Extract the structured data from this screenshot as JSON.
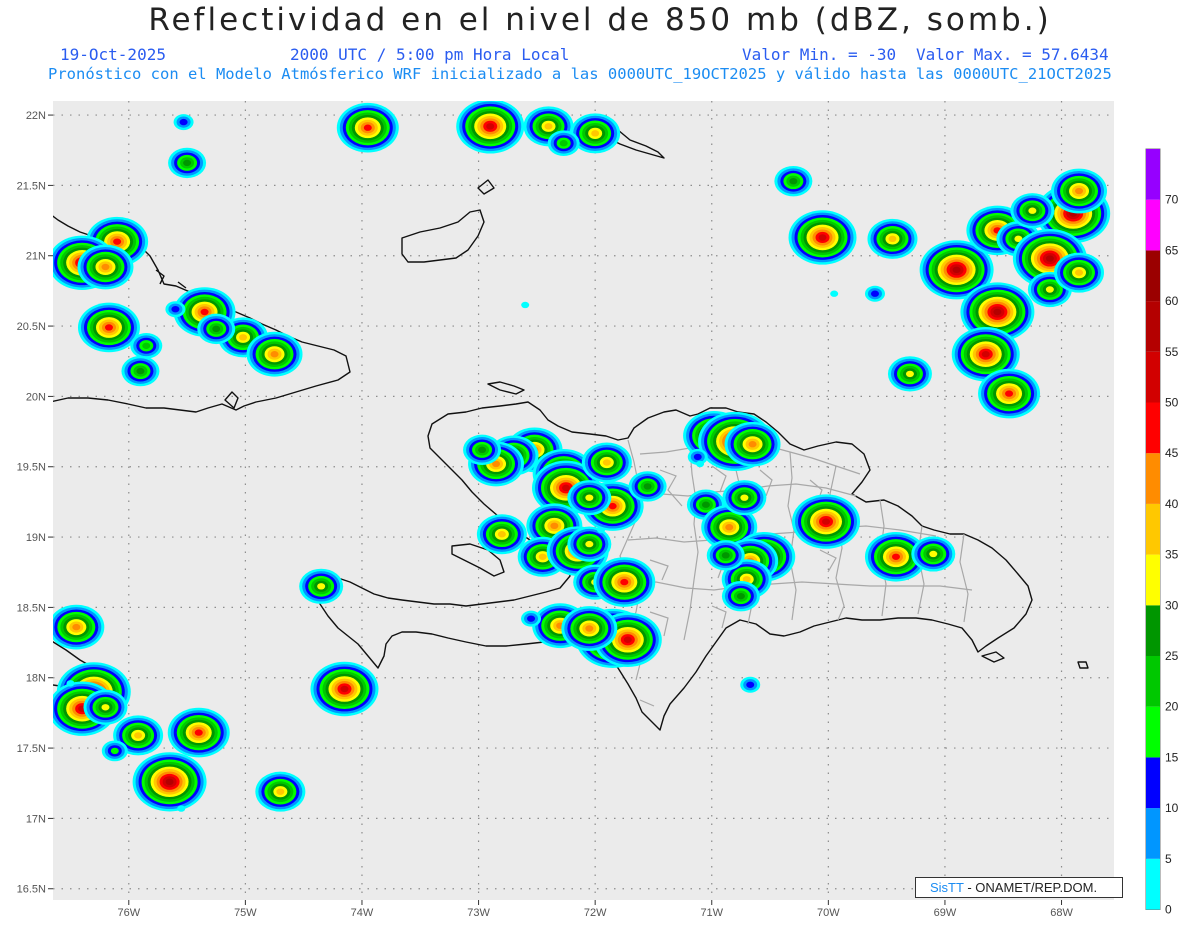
{
  "title": "Reflectividad en el nivel de 850 mb (dBZ, somb.)",
  "subtitle": {
    "date": "19-Oct-2025",
    "time": "2000 UTC / 5:00 pm Hora Local",
    "valor_min": "Valor Min. = -30",
    "valor_max": "Valor Max. = 57.6434"
  },
  "description": "Pronóstico con el Modelo Atmósferico WRF inicializado a las 0000UTC_19OCT2025 y válido hasta las  0000UTC_21OCT2025",
  "credit": {
    "sis": "SisTT",
    "org": " - ONAMET/REP.DOM."
  },
  "map": {
    "lon_range": [
      -76.65,
      -67.55
    ],
    "lat_range": [
      16.42,
      22.1
    ],
    "lat_labels": [
      "22N",
      "21.5N",
      "21N",
      "20.5N",
      "20N",
      "19.5N",
      "19N",
      "18.5N",
      "18N",
      "17.5N",
      "17N",
      "16.5N"
    ],
    "lat_values": [
      22,
      21.5,
      21,
      20.5,
      20,
      19.5,
      19,
      18.5,
      18,
      17.5,
      17,
      16.5
    ],
    "lon_labels": [
      "76W",
      "75W",
      "74W",
      "73W",
      "72W",
      "71W",
      "70W",
      "69W",
      "68W"
    ],
    "lon_values": [
      -76,
      -75,
      -74,
      -73,
      -72,
      -71,
      -70,
      -69,
      -68
    ],
    "background": "#ebebeb"
  },
  "colorbar": {
    "levels": [
      "0",
      "5",
      "10",
      "15",
      "20",
      "25",
      "30",
      "35",
      "40",
      "45",
      "50",
      "55",
      "60",
      "65",
      "70"
    ],
    "colors": [
      "#00ffff",
      "#0096ff",
      "#0000ff",
      "#00ff00",
      "#00c800",
      "#009600",
      "#ffff00",
      "#ffc800",
      "#ff8c00",
      "#ff0000",
      "#d20000",
      "#b40000",
      "#9b0000",
      "#ff00ff",
      "#9600ff"
    ]
  },
  "echoes": [
    {
      "lon": -75.53,
      "lat": 21.95,
      "dbz": 12
    },
    {
      "lon": -75.5,
      "lat": 21.66,
      "dbz": 28
    },
    {
      "lon": -73.95,
      "lat": 21.91,
      "dbz": 45
    },
    {
      "lon": -72.9,
      "lat": 21.92,
      "dbz": 50
    },
    {
      "lon": -72.4,
      "lat": 21.92,
      "dbz": 35
    },
    {
      "lon": -72.0,
      "lat": 21.87,
      "dbz": 35
    },
    {
      "lon": -72.27,
      "lat": 21.8,
      "dbz": 20
    },
    {
      "lon": -70.3,
      "lat": 21.53,
      "dbz": 28
    },
    {
      "lon": -76.1,
      "lat": 21.1,
      "dbz": 45
    },
    {
      "lon": -76.4,
      "lat": 20.95,
      "dbz": 50
    },
    {
      "lon": -76.2,
      "lat": 20.92,
      "dbz": 40
    },
    {
      "lon": -75.35,
      "lat": 20.6,
      "dbz": 45
    },
    {
      "lon": -75.02,
      "lat": 20.42,
      "dbz": 35
    },
    {
      "lon": -74.75,
      "lat": 20.3,
      "dbz": 40
    },
    {
      "lon": -76.17,
      "lat": 20.49,
      "dbz": 45
    },
    {
      "lon": -75.6,
      "lat": 20.62,
      "dbz": 10
    },
    {
      "lon": -75.25,
      "lat": 20.48,
      "dbz": 25
    },
    {
      "lon": -75.85,
      "lat": 20.36,
      "dbz": 20
    },
    {
      "lon": -75.9,
      "lat": 20.18,
      "dbz": 25
    },
    {
      "lon": -72.6,
      "lat": 20.65,
      "dbz": 3
    },
    {
      "lon": -70.05,
      "lat": 21.13,
      "dbz": 50
    },
    {
      "lon": -69.45,
      "lat": 21.12,
      "dbz": 35
    },
    {
      "lon": -68.9,
      "lat": 20.9,
      "dbz": 55
    },
    {
      "lon": -68.55,
      "lat": 21.18,
      "dbz": 45
    },
    {
      "lon": -68.37,
      "lat": 21.12,
      "dbz": 30
    },
    {
      "lon": -67.9,
      "lat": 21.3,
      "dbz": 55
    },
    {
      "lon": -67.85,
      "lat": 21.46,
      "dbz": 40
    },
    {
      "lon": -68.1,
      "lat": 20.98,
      "dbz": 55
    },
    {
      "lon": -68.25,
      "lat": 21.32,
      "dbz": 30
    },
    {
      "lon": -68.55,
      "lat": 20.6,
      "dbz": 57.6
    },
    {
      "lon": -68.65,
      "lat": 20.3,
      "dbz": 50
    },
    {
      "lon": -69.6,
      "lat": 20.73,
      "dbz": 12
    },
    {
      "lon": -69.95,
      "lat": 20.73,
      "dbz": 2
    },
    {
      "lon": -69.3,
      "lat": 20.16,
      "dbz": 30
    },
    {
      "lon": -68.45,
      "lat": 20.02,
      "dbz": 45
    },
    {
      "lon": -68.1,
      "lat": 20.76,
      "dbz": 30
    },
    {
      "lon": -67.85,
      "lat": 20.88,
      "dbz": 35
    },
    {
      "lon": -72.52,
      "lat": 19.62,
      "dbz": 40
    },
    {
      "lon": -72.27,
      "lat": 19.45,
      "dbz": 45
    },
    {
      "lon": -72.25,
      "lat": 19.35,
      "dbz": 50
    },
    {
      "lon": -72.7,
      "lat": 19.58,
      "dbz": 35
    },
    {
      "lon": -72.85,
      "lat": 19.52,
      "dbz": 40
    },
    {
      "lon": -72.97,
      "lat": 19.62,
      "dbz": 25
    },
    {
      "lon": -71.9,
      "lat": 19.53,
      "dbz": 35
    },
    {
      "lon": -71.85,
      "lat": 19.22,
      "dbz": 45
    },
    {
      "lon": -72.05,
      "lat": 19.28,
      "dbz": 30
    },
    {
      "lon": -72.8,
      "lat": 19.02,
      "dbz": 35
    },
    {
      "lon": -72.35,
      "lat": 19.08,
      "dbz": 40
    },
    {
      "lon": -72.45,
      "lat": 18.86,
      "dbz": 35
    },
    {
      "lon": -72.15,
      "lat": 18.9,
      "dbz": 45
    },
    {
      "lon": -72.05,
      "lat": 18.95,
      "dbz": 30
    },
    {
      "lon": -72.0,
      "lat": 18.68,
      "dbz": 30
    },
    {
      "lon": -71.75,
      "lat": 18.68,
      "dbz": 45
    },
    {
      "lon": -71.55,
      "lat": 19.36,
      "dbz": 25
    },
    {
      "lon": -70.98,
      "lat": 19.72,
      "dbz": 45
    },
    {
      "lon": -70.8,
      "lat": 19.68,
      "dbz": 55
    },
    {
      "lon": -70.65,
      "lat": 19.66,
      "dbz": 40
    },
    {
      "lon": -71.05,
      "lat": 19.23,
      "dbz": 25
    },
    {
      "lon": -71.12,
      "lat": 19.57,
      "dbz": 12
    },
    {
      "lon": -70.85,
      "lat": 19.07,
      "dbz": 40
    },
    {
      "lon": -70.72,
      "lat": 19.28,
      "dbz": 30
    },
    {
      "lon": -70.02,
      "lat": 19.11,
      "dbz": 50
    },
    {
      "lon": -69.42,
      "lat": 18.86,
      "dbz": 45
    },
    {
      "lon": -69.1,
      "lat": 18.88,
      "dbz": 30
    },
    {
      "lon": -70.55,
      "lat": 18.86,
      "dbz": 45
    },
    {
      "lon": -70.67,
      "lat": 18.83,
      "dbz": 40
    },
    {
      "lon": -70.7,
      "lat": 18.7,
      "dbz": 35
    },
    {
      "lon": -70.75,
      "lat": 18.58,
      "dbz": 25
    },
    {
      "lon": -70.88,
      "lat": 18.87,
      "dbz": 25
    },
    {
      "lon": -74.35,
      "lat": 18.65,
      "dbz": 30
    },
    {
      "lon": -72.3,
      "lat": 18.37,
      "dbz": 40
    },
    {
      "lon": -71.85,
      "lat": 18.28,
      "dbz": 55
    },
    {
      "lon": -71.72,
      "lat": 18.27,
      "dbz": 50
    },
    {
      "lon": -72.05,
      "lat": 18.35,
      "dbz": 40
    },
    {
      "lon": -72.55,
      "lat": 18.42,
      "dbz": 12
    },
    {
      "lon": -74.15,
      "lat": 17.92,
      "dbz": 50
    },
    {
      "lon": -70.67,
      "lat": 17.95,
      "dbz": 12
    },
    {
      "lon": -76.45,
      "lat": 18.36,
      "dbz": 40
    },
    {
      "lon": -76.3,
      "lat": 17.9,
      "dbz": 55
    },
    {
      "lon": -76.4,
      "lat": 17.78,
      "dbz": 50
    },
    {
      "lon": -76.2,
      "lat": 17.79,
      "dbz": 30
    },
    {
      "lon": -75.92,
      "lat": 17.59,
      "dbz": 35
    },
    {
      "lon": -75.4,
      "lat": 17.61,
      "dbz": 45
    },
    {
      "lon": -76.12,
      "lat": 17.48,
      "dbz": 15
    },
    {
      "lon": -75.65,
      "lat": 17.26,
      "dbz": 55
    },
    {
      "lon": -74.7,
      "lat": 17.19,
      "dbz": 35
    },
    {
      "lon": -75.55,
      "lat": 17.07,
      "dbz": 3
    },
    {
      "lon": -71.1,
      "lat": 19.52,
      "dbz": 3
    },
    {
      "lon": -71.95,
      "lat": 19.05,
      "dbz": 2
    },
    {
      "lon": -76.5,
      "lat": 17.96,
      "dbz": 3
    }
  ]
}
